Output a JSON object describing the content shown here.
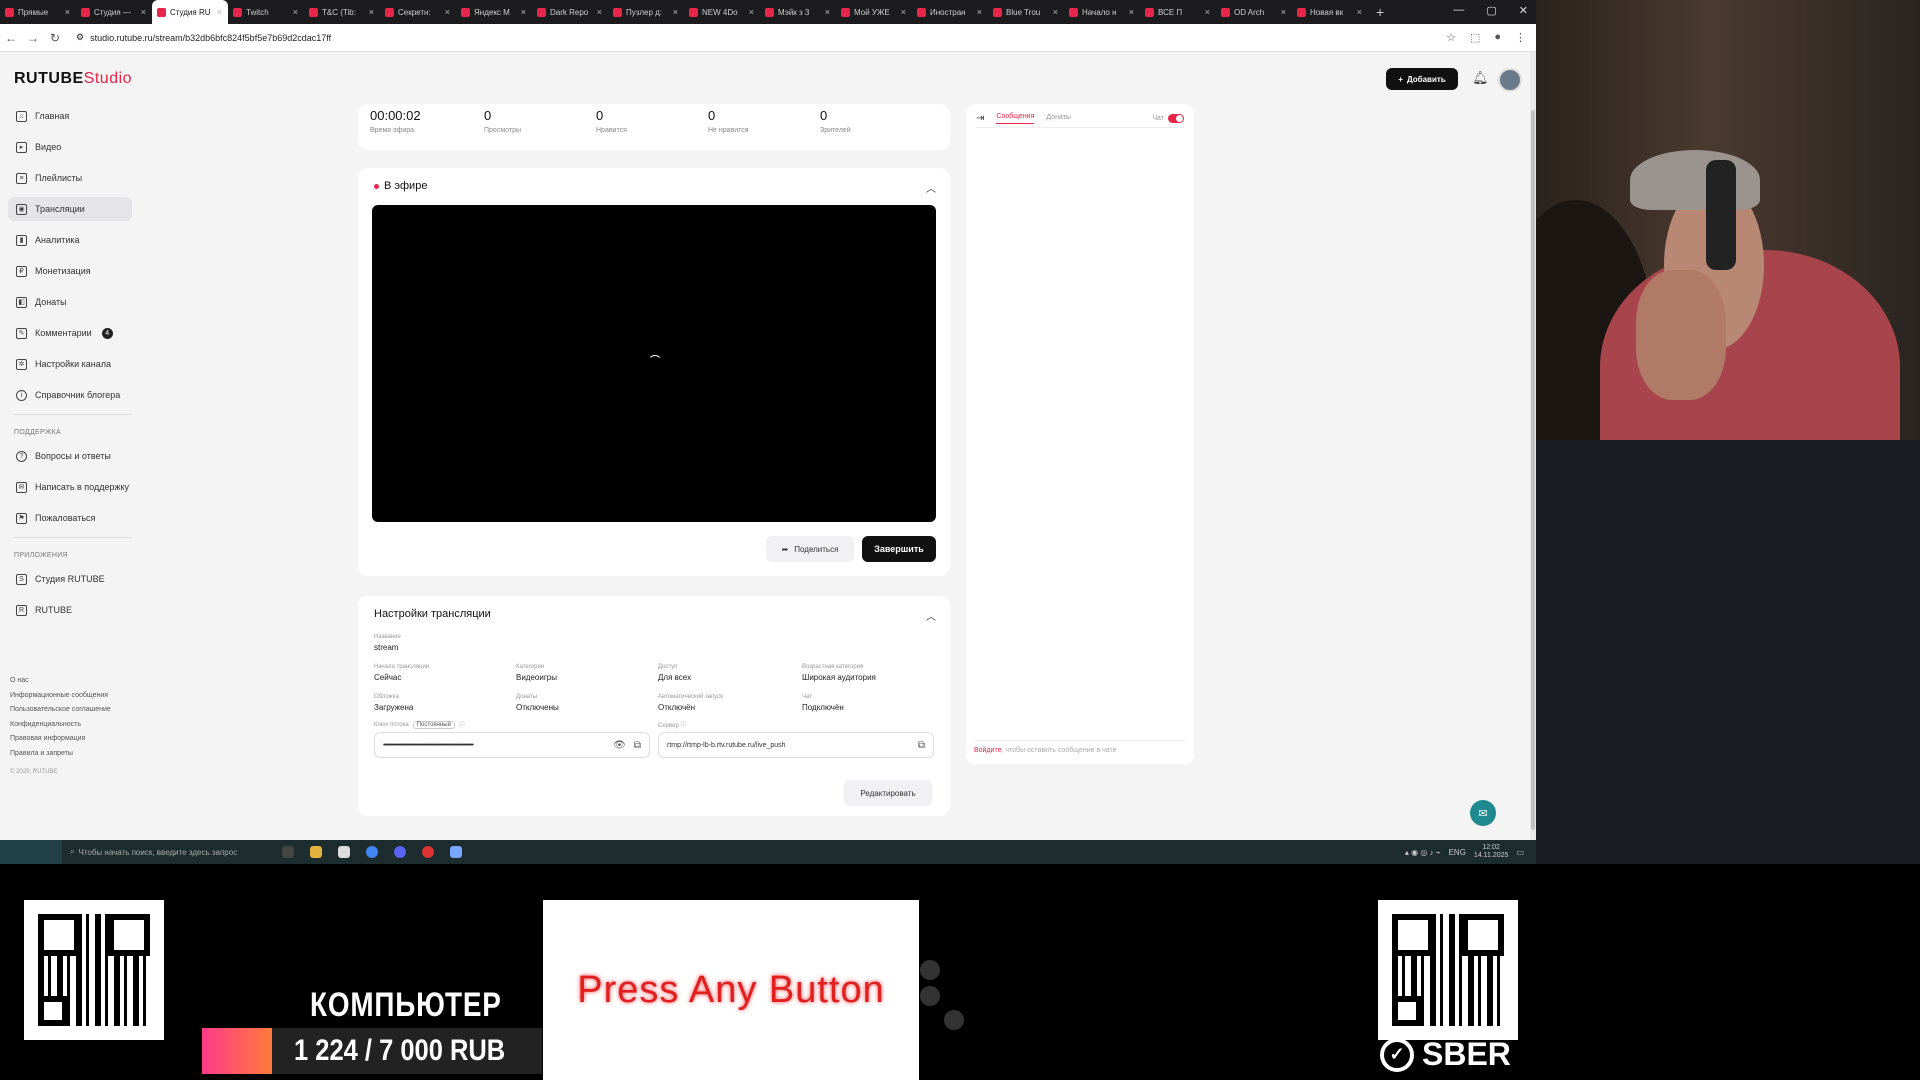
{
  "browser": {
    "tabs": [
      {
        "label": "Прямые",
        "active": false
      },
      {
        "label": "Студия —",
        "active": false
      },
      {
        "label": "Студия RU",
        "active": true
      },
      {
        "label": "Twitch",
        "active": false
      },
      {
        "label": "T&C (Tib:",
        "active": false
      },
      {
        "label": "Секретн:",
        "active": false
      },
      {
        "label": "Яндекс М",
        "active": false
      },
      {
        "label": "Dark Repo",
        "active": false
      },
      {
        "label": "Пузлер д:",
        "active": false
      },
      {
        "label": "NEW 4Do",
        "active": false
      },
      {
        "label": "Мэйк з 3",
        "active": false
      },
      {
        "label": "Мой УЖЕ",
        "active": false
      },
      {
        "label": "Иностран",
        "active": false
      },
      {
        "label": "Blue Trou",
        "active": false
      },
      {
        "label": "Начало н",
        "active": false
      },
      {
        "label": "ВСЕ П",
        "active": false
      },
      {
        "label": "OD Arch",
        "active": false
      },
      {
        "label": "Новая вк",
        "active": false
      }
    ],
    "new_tab": "+",
    "url": "studio.rutube.ru/stream/b32db6bfc824f5bf5e7b69d2cdac17ff"
  },
  "header": {
    "logo_main": "RUTUBE",
    "logo_studio": "Studio",
    "add_button": "Добавить"
  },
  "sidebar": {
    "items": [
      {
        "label": "Главная",
        "icon": "home-icon"
      },
      {
        "label": "Видео",
        "icon": "video-icon"
      },
      {
        "label": "Плейлисты",
        "icon": "playlist-icon"
      },
      {
        "label": "Трансляции",
        "icon": "broadcast-icon",
        "active": true
      },
      {
        "label": "Аналитика",
        "icon": "analytics-icon"
      },
      {
        "label": "Монетизация",
        "icon": "monetization-icon"
      },
      {
        "label": "Донаты",
        "icon": "donate-icon"
      },
      {
        "label": "Комментарии",
        "icon": "comments-icon",
        "badge": "4"
      },
      {
        "label": "Настройки канала",
        "icon": "settings-icon"
      },
      {
        "label": "Справочник блогера",
        "icon": "info-icon"
      }
    ],
    "support_title": "Поддержка",
    "support_items": [
      {
        "label": "Вопросы и ответы",
        "icon": "help-icon"
      },
      {
        "label": "Написать в поддержку",
        "icon": "mail-icon"
      },
      {
        "label": "Пожаловаться",
        "icon": "flag-icon"
      }
    ],
    "apps_title": "Приложения",
    "apps_items": [
      {
        "label": "Студия RUTUBE",
        "icon": "studio-app-icon"
      },
      {
        "label": "RUTUBE",
        "icon": "rutube-app-icon"
      }
    ],
    "footer_links": [
      "О нас",
      "Информационные сообщения",
      "Пользовательское соглашение",
      "Конфиденциальность",
      "Правовая информация",
      "Правила и запреты"
    ],
    "copyright": "© 2025, RUTUBE"
  },
  "stats": [
    {
      "value": "00:00:02",
      "label": "Время эфира"
    },
    {
      "value": "0",
      "label": "Просмотры"
    },
    {
      "value": "0",
      "label": "Нравится"
    },
    {
      "value": "0",
      "label": "Не нравится"
    },
    {
      "value": "0",
      "label": "Зрителей"
    }
  ],
  "live": {
    "title": "В эфире",
    "share_button": "Поделиться",
    "finish_button": "Завершить"
  },
  "settings": {
    "title": "Настройки трансляции",
    "name_label": "Название",
    "name_value": "stream",
    "fields": [
      {
        "label": "Начало трансляции",
        "value": "Сейчас"
      },
      {
        "label": "Категория",
        "value": "Видеоигры"
      },
      {
        "label": "Доступ",
        "value": "Для всех"
      },
      {
        "label": "Возрастная категория",
        "value": "Широкая аудитория"
      },
      {
        "label": "Обложка",
        "value": "Загружена"
      },
      {
        "label": "Донаты",
        "value": "Отключены"
      },
      {
        "label": "Автоматический запуск",
        "value": "Отключён"
      },
      {
        "label": "Чат",
        "value": "Подключён"
      }
    ],
    "key_label": "Ключ потока",
    "key_chip": "Постоянный",
    "key_value": "••••••••••••••••••••••••••••••••••••••••••••••••••••••••••••••",
    "server_label": "Сервер",
    "server_value": "rtmp://rtmp-lb-b.rtv.rutube.ru/live_push",
    "edit_button": "Редактировать"
  },
  "chat": {
    "tab_messages": "Сообщения",
    "tab_donates": "Донаты",
    "toggle_label": "Чат",
    "login_link": "Войдите",
    "login_text": ", чтобы оставить сообщение в чате"
  },
  "taskbar": {
    "search_placeholder": "Чтобы начать поиск, введите здесь запрос",
    "lang": "ENG",
    "time": "12:02",
    "date": "14.11.2025"
  },
  "overlay": {
    "label": "КОМПЬЮТЕР",
    "amount": "1 224 / 7 000 RUB",
    "press_text": "Press Any Button",
    "sber": "SBER"
  },
  "colors": {
    "brand_red": "#e8254a",
    "finish_button_bg": "#111111",
    "fab_teal": "#1f8a8f"
  }
}
